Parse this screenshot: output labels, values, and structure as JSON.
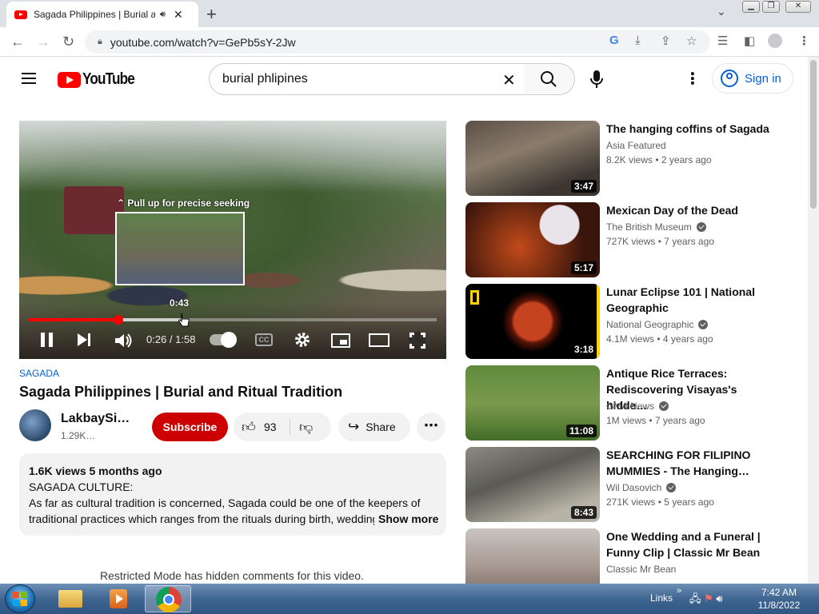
{
  "browser": {
    "tab_title": "Sagada Philippines | Burial and Ritual Tradition",
    "new_tab": "+",
    "tab_close": "✕",
    "url": "youtube.com/watch?v=GePb5sY-2Jw"
  },
  "header": {
    "logo_text": "YouTube",
    "search_value": "burial phlipines",
    "sign_in": "Sign in"
  },
  "player": {
    "seek_hint": "⌃ Pull up for precise seeking",
    "preview_time": "0:43",
    "time_display": "0:26 / 1:58",
    "progress_fraction": 0.22,
    "buffered_fraction": 0.38,
    "cc_label": "CC"
  },
  "video": {
    "hashtag": "SAGADA",
    "title": "Sagada Philippines | Burial and Ritual Tradition",
    "channel_name": "LakbaySiklista",
    "channel_subs": "1.29K…",
    "subscribe": "Subscribe",
    "likes": "93",
    "share": "Share"
  },
  "description": {
    "meta": "1.6K views  5 months ago",
    "line1": "SAGADA CULTURE:",
    "line2": "As far as cultural tradition is concerned, Sagada could be one of the keepers of",
    "line3": "traditional practices which ranges from the rituals during birth, wedding",
    "show_more": "Show more"
  },
  "comments_notice": "Restricted Mode has hidden comments for this video.",
  "recommendations": [
    {
      "title": "The hanging coffins of Sagada",
      "channel": "Asia Featured",
      "verified": false,
      "meta": "8.2K views  • 2 years ago",
      "duration": "3:47"
    },
    {
      "title": "Mexican Day of the Dead",
      "channel": "The British Museum",
      "verified": true,
      "meta": "727K views  • 7 years ago",
      "duration": "5:17"
    },
    {
      "title": "Lunar Eclipse 101 | National Geographic",
      "channel": "National Geographic",
      "verified": true,
      "meta": "4.1M views  • 4 years ago",
      "duration": "3:18"
    },
    {
      "title": "Antique Rice Terraces: Rediscovering Visayas's hidde…",
      "channel": "GMA News",
      "verified": true,
      "meta": "1M views  • 7 years ago",
      "duration": "11:08"
    },
    {
      "title": "SEARCHING FOR FILIPINO MUMMIES - The Hanging…",
      "channel": "Wil Dasovich",
      "verified": true,
      "meta": "271K views  • 5 years ago",
      "duration": "8:43"
    },
    {
      "title": "One Wedding and a Funeral | Funny Clip | Classic Mr Bean",
      "channel": "Classic Mr Bean",
      "verified": false,
      "meta": "",
      "duration": ""
    }
  ],
  "taskbar": {
    "links": "Links",
    "time": "7:42 AM",
    "date": "11/8/2022"
  }
}
